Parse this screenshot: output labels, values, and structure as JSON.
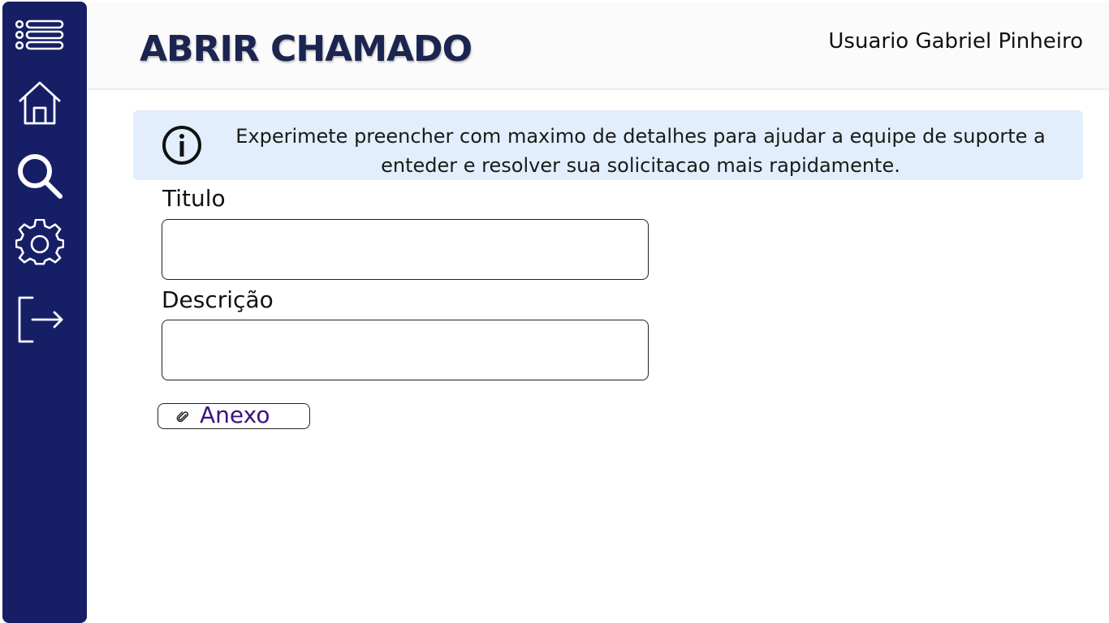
{
  "sidebar": {
    "items": [
      {
        "name": "menu",
        "icon": "list-icon"
      },
      {
        "name": "home",
        "icon": "home-icon"
      },
      {
        "name": "search",
        "icon": "search-icon"
      },
      {
        "name": "settings",
        "icon": "gear-icon"
      },
      {
        "name": "logout",
        "icon": "logout-icon"
      }
    ],
    "background": "#161f66"
  },
  "header": {
    "title": "ABRIR CHAMADO",
    "user_label": "Usuario Gabriel Pinheiro"
  },
  "info": {
    "icon": "info-icon",
    "line1": "Experimete preencher com maximo de detalhes para ajudar a equipe de suporte a",
    "line2": "enteder e resolver sua solicitacao mais rapidamente.",
    "background": "#e2eefb"
  },
  "form": {
    "title_label": "Titulo",
    "title_value": "",
    "description_label": "Descrição",
    "description_value": "",
    "attach_label": "Anexo",
    "attach_icon": "paperclip-icon"
  }
}
